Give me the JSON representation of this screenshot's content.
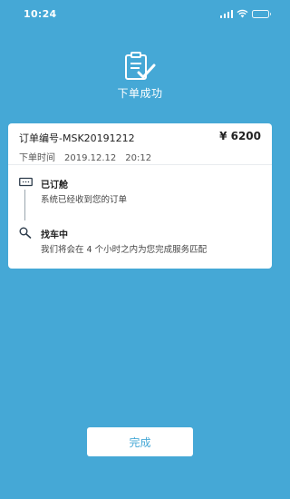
{
  "status_bar": {
    "time": "10:24"
  },
  "header": {
    "title": "下单成功"
  },
  "order": {
    "number": "订单编号-MSK20191212",
    "time_label": "下单时间",
    "date": "2019.12.12",
    "clock": "20:12",
    "price": "¥ 6200"
  },
  "steps": [
    {
      "title": "已订舱",
      "desc": "系统已经收到您的订单",
      "icon": "ticket-icon"
    },
    {
      "title": "找车中",
      "desc": "我们将会在 4 个小时之内为您完成服务匹配",
      "icon": "search-icon"
    }
  ],
  "footer": {
    "done_label": "完成"
  },
  "colors": {
    "background": "#45A8D6",
    "card": "#FFFFFF",
    "button_text": "#45A8D6"
  }
}
